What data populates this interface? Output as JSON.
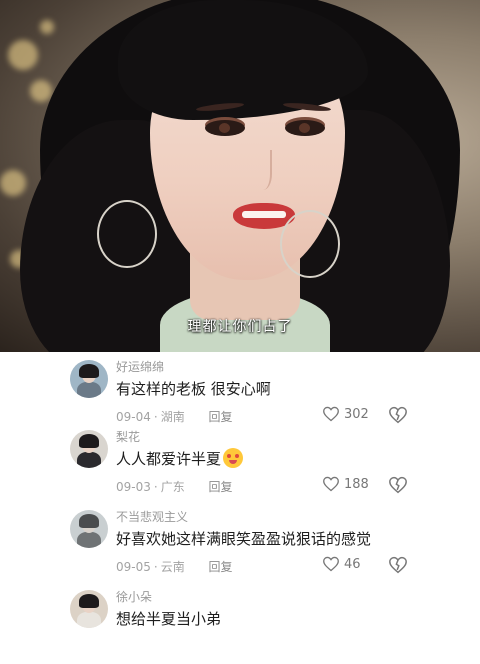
{
  "video": {
    "subtitle": "理都让你们占了"
  },
  "comments": [
    {
      "username": "好运绵绵",
      "text": "有这样的老板 很安心啊",
      "date": "09-04",
      "location": "湖南",
      "reply_label": "回复",
      "likes": "302",
      "has_emoji": false
    },
    {
      "username": "梨花",
      "text": "人人都爱许半夏",
      "date": "09-03",
      "location": "广东",
      "reply_label": "回复",
      "likes": "188",
      "has_emoji": true
    },
    {
      "username": "不当悲观主义",
      "text": "好喜欢她这样满眼笑盈盈说狠话的感觉",
      "date": "09-05",
      "location": "云南",
      "reply_label": "回复",
      "likes": "46",
      "has_emoji": false
    },
    {
      "username": "徐小朵",
      "text": "想给半夏当小弟"
    }
  ],
  "icons": {
    "like": "heart-outline-icon",
    "dislike": "broken-heart-icon"
  },
  "colors": {
    "username": "#9a9a9a",
    "text": "#1e1e1e",
    "meta": "#a3a3a3"
  }
}
